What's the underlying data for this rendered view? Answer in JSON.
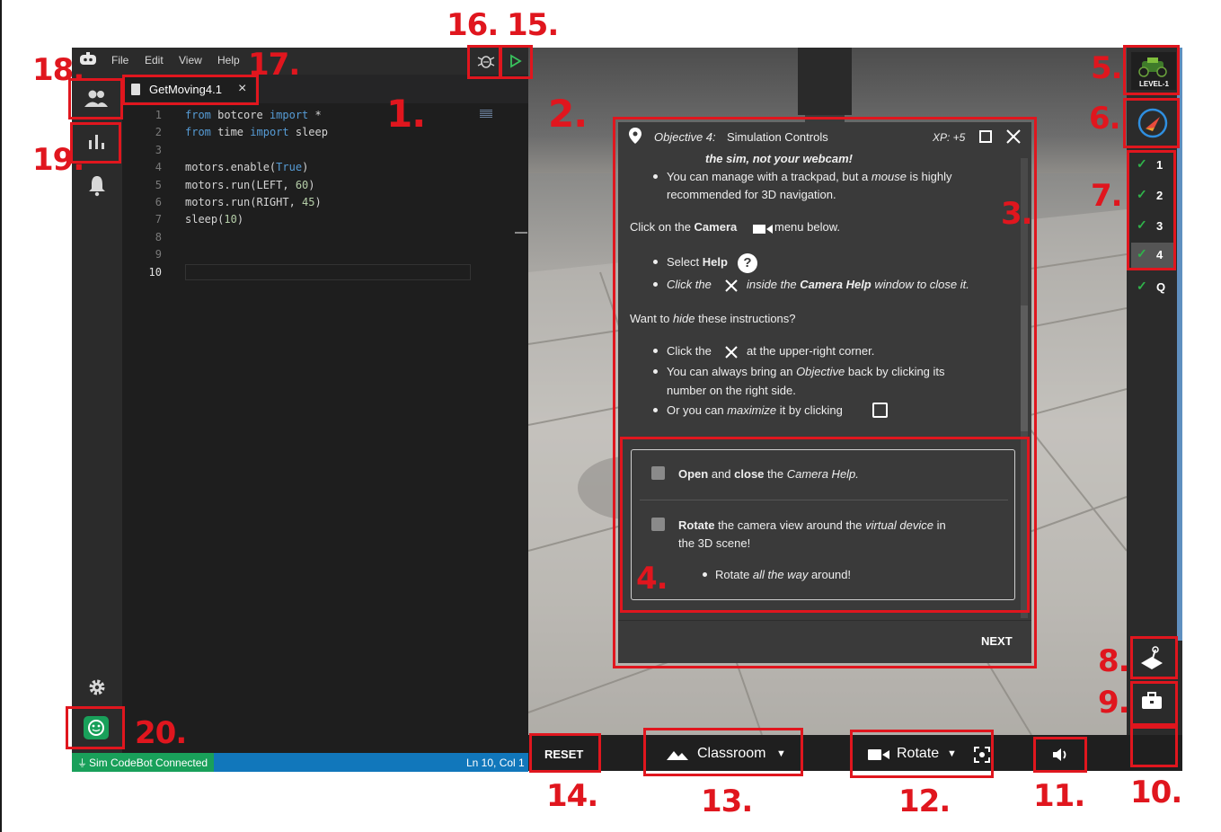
{
  "ide": {
    "menu": [
      "File",
      "Edit",
      "View",
      "Help"
    ],
    "tab_title": "GetMoving4.1",
    "tab_close": "×",
    "line_numbers": [
      "1",
      "2",
      "3",
      "4",
      "5",
      "6",
      "7",
      "8",
      "9",
      "10"
    ],
    "code": {
      "l1_kw1": "from",
      "l1_mod": " botcore ",
      "l1_kw2": "import",
      "l1_rest": " *",
      "l2_kw1": "from",
      "l2_mod": " time ",
      "l2_kw2": "import",
      "l2_rest": " sleep",
      "l4_a": "motors.enable(",
      "l4_b": "True",
      "l4_c": ")",
      "l5_a": "motors.run(LEFT, ",
      "l5_b": "60",
      "l5_c": ")",
      "l6_a": "motors.run(RIGHT, ",
      "l6_b": "45",
      "l6_c": ")",
      "l7_a": "sleep(",
      "l7_b": "10",
      "l7_c": ")"
    },
    "status_left": "Sim CodeBot Connected",
    "status_right": "Ln 10, Col 1"
  },
  "objective": {
    "title_prefix": "Objective 4:",
    "title": "Simulation Controls",
    "xp": "XP: +5",
    "cut_line": "the sim, not your webcam!",
    "b1_a": "You can manage with a trackpad, but a ",
    "b1_em": "mouse",
    "b1_b": " is highly",
    "b1_line2": "recommended for 3D navigation.",
    "camera_a": "Click on the ",
    "camera_b": "Camera",
    "camera_c": " menu below.",
    "select_a": "Select ",
    "select_b": "Help",
    "clickx_a": "Click the",
    "clickx_b": "inside the ",
    "clickx_c": "Camera Help",
    "clickx_d": " window to close it.",
    "hide_a": "Want to ",
    "hide_em": "hide",
    "hide_b": " these instructions?",
    "h1_a": "Click the",
    "h1_b": "at the upper-right corner.",
    "h2_a": "You can always bring an ",
    "h2_em": "Objective",
    "h2_b": " back by clicking its",
    "h2_line2": "number on the right side.",
    "h3_a": "Or you can ",
    "h3_em": "maximize",
    "h3_b": " it by clicking",
    "task1_a": "Open",
    "task1_b": " and ",
    "task1_c": "close",
    "task1_d": " the ",
    "task1_e": "Camera Help.",
    "task2_a": "Rotate",
    "task2_b": " the camera view around the ",
    "task2_em": "virtual device",
    "task2_c": " in",
    "task2_line2": "the 3D scene!",
    "task2_sub_a": "Rotate ",
    "task2_sub_em": "all the way",
    "task2_sub_b": " around!",
    "next": "NEXT"
  },
  "right": {
    "level_badge": "LEVEL-1",
    "objective_nums": [
      "1",
      "2",
      "3",
      "4",
      "Q"
    ]
  },
  "bottombar": {
    "reset": "RESET",
    "env": "Classroom",
    "camera": "Rotate"
  },
  "annotations": {
    "a1": "1.",
    "a2": "2.",
    "a3": "3.",
    "a4": "4.",
    "a5": "5.",
    "a6": "6.",
    "a7": "7.",
    "a8": "8.",
    "a9": "9.",
    "a10": "10.",
    "a11": "11.",
    "a12": "12.",
    "a13": "13.",
    "a14": "14.",
    "a15": "15.",
    "a16": "16.",
    "a17": "17.",
    "a18": "18.",
    "a19": "19.",
    "a20": "20."
  },
  "colors": {
    "annotation_red": "#e0161e",
    "status_green": "#19a05a",
    "status_blue": "#1177bb",
    "check_green": "#2fb34a"
  }
}
